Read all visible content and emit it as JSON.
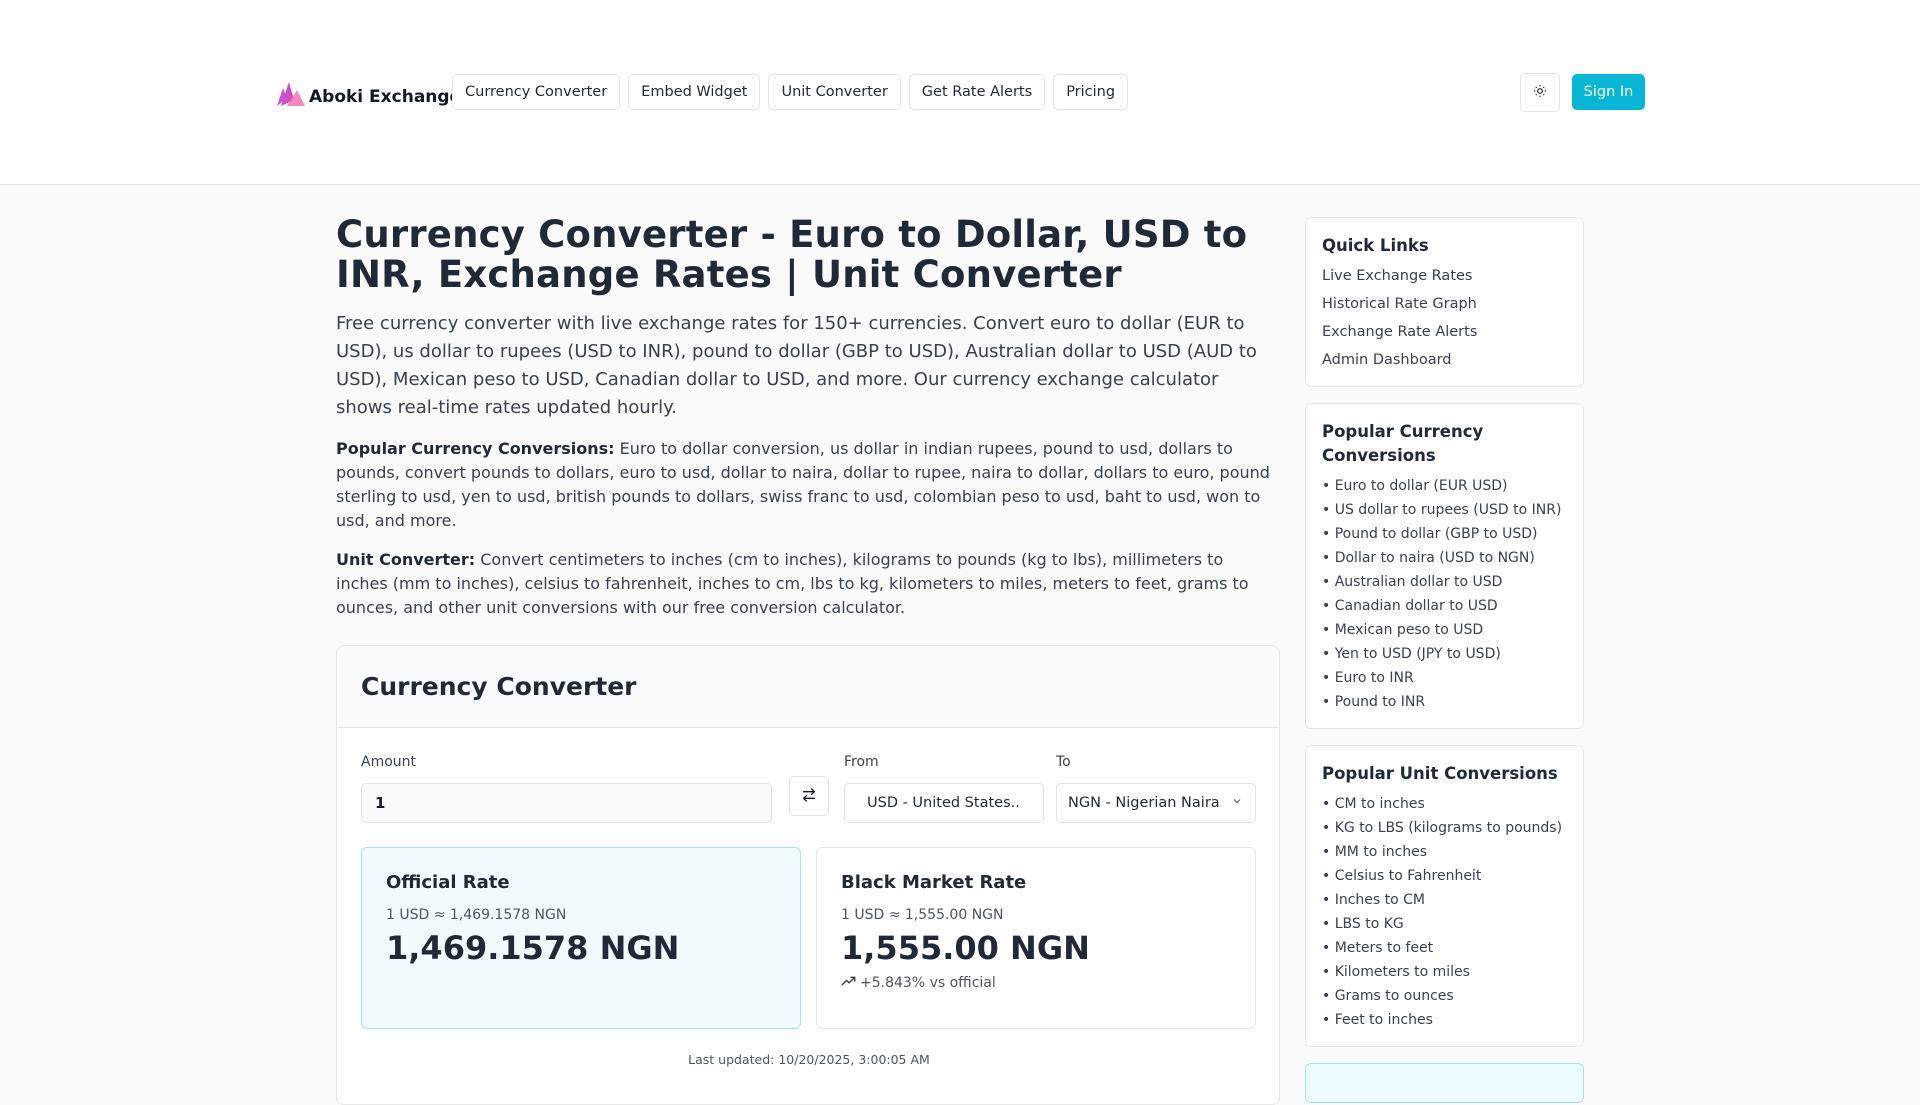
{
  "header": {
    "brand": "Aboki Exchange",
    "nav": [
      "Currency Converter",
      "Embed Widget",
      "Unit Converter",
      "Get Rate Alerts",
      "Pricing"
    ],
    "theme_icon": "sun-icon",
    "signin_label": "Sign In",
    "accent_color": "#06b6d4"
  },
  "main": {
    "title": "Currency Converter - Euro to Dollar, USD to INR, Exchange Rates | Unit Converter",
    "lead": "Free currency converter with live exchange rates for 150+ currencies. Convert euro to dollar (EUR to USD), us dollar to rupees (USD to INR), pound to dollar (GBP to USD), Australian dollar to USD (AUD to USD), Mexican peso to USD, Canadian dollar to USD, and more. Our currency exchange calculator shows real-time rates updated hourly.",
    "popular_label": "Popular Currency Conversions:",
    "popular_text": " Euro to dollar conversion, us dollar in indian rupees, pound to usd, dollars to pounds, convert pounds to dollars, euro to usd, dollar to naira, dollar to rupee, naira to dollar, dollars to euro, pound sterling to usd, yen to usd, british pounds to dollars, swiss franc to usd, colombian peso to usd, baht to usd, won to usd, and more.",
    "unit_label": "Unit Converter:",
    "unit_text": " Convert centimeters to inches (cm to inches), kilograms to pounds (kg to lbs), millimeters to inches (mm to inches), celsius to fahrenheit, inches to cm, lbs to kg, kilometers to miles, meters to feet, grams to ounces, and other unit conversions with our free conversion calculator."
  },
  "converter": {
    "title": "Currency Converter",
    "amount_label": "Amount",
    "amount_value": "1",
    "from_label": "From",
    "from_value": "USD - United States..",
    "to_label": "To",
    "to_value": "NGN - Nigerian Naira",
    "official": {
      "title": "Official Rate",
      "small": "1 USD ≈ 1,469.1578 NGN",
      "big": "1,469.1578 NGN"
    },
    "black": {
      "title": "Black Market Rate",
      "small": "1 USD ≈ 1,555.00 NGN",
      "big": "1,555.00 NGN",
      "change": "+5.843% vs official"
    },
    "last_updated": "Last updated: 10/20/2025, 3:00:05 AM"
  },
  "sidebar": {
    "quick_links": {
      "title": "Quick Links",
      "items": [
        "Live Exchange Rates",
        "Historical Rate Graph",
        "Exchange Rate Alerts",
        "Admin Dashboard"
      ]
    },
    "popular_currency": {
      "title": "Popular Currency Conversions",
      "items": [
        "• Euro to dollar (EUR USD)",
        "• US dollar to rupees (USD to INR)",
        "• Pound to dollar (GBP to USD)",
        "• Dollar to naira (USD to NGN)",
        "• Australian dollar to USD",
        "• Canadian dollar to USD",
        "• Mexican peso to USD",
        "• Yen to USD (JPY to USD)",
        "• Euro to INR",
        "• Pound to INR"
      ]
    },
    "popular_unit": {
      "title": "Popular Unit Conversions",
      "items": [
        "• CM to inches",
        "• KG to LBS (kilograms to pounds)",
        "• MM to inches",
        "• Celsius to Fahrenheit",
        "• Inches to CM",
        "• LBS to KG",
        "• Meters to feet",
        "• Kilometers to miles",
        "• Grams to ounces",
        "• Feet to inches"
      ]
    }
  }
}
